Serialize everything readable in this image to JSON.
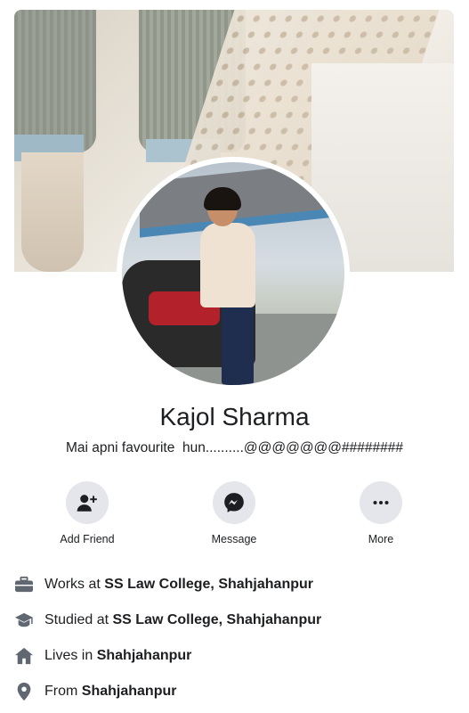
{
  "profile": {
    "name": "Kajol Sharma",
    "bio": "Mai apni favourite  hun..........@@@@@@@########"
  },
  "actions": [
    {
      "label": "Add Friend",
      "icon": "add-friend-icon"
    },
    {
      "label": "Message",
      "icon": "messenger-icon"
    },
    {
      "label": "More",
      "icon": "more-dots-icon"
    }
  ],
  "details": [
    {
      "prefix": "Works at ",
      "value": "SS Law College, Shahjahanpur",
      "icon": "briefcase-icon"
    },
    {
      "prefix": "Studied at ",
      "value": "SS Law College, Shahjahanpur",
      "icon": "graduation-cap-icon"
    },
    {
      "prefix": "Lives in ",
      "value": "Shahjahanpur",
      "icon": "home-icon"
    },
    {
      "prefix": "From ",
      "value": "Shahjahanpur",
      "icon": "location-pin-icon"
    }
  ],
  "colors": {
    "icon": "#606770",
    "button_bg": "#e4e6eb",
    "text": "#1c1e21"
  }
}
